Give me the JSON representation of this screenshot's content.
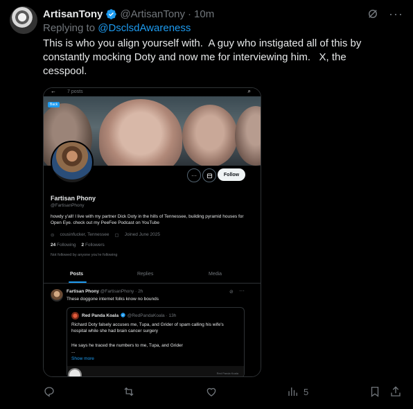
{
  "author": {
    "name": "ArtisanTony",
    "handle": "@ArtisanTony",
    "separator": "·",
    "time": "10m",
    "verified": true
  },
  "reply": {
    "prefix": "Replying to ",
    "handle": "@DsclsdAwareness"
  },
  "tweet": {
    "text": "This is who you align yourself with.  A guy who instigated all of this by constantly mocking Doty and now me for interviewing him.   X, the cesspool."
  },
  "screenshot": {
    "topbar": {
      "back": "←",
      "posts_count": "7 posts",
      "search": "⌕"
    },
    "back_chip": "Back",
    "profile": {
      "name": "Fartisan Phony",
      "handle": "@FartisanPhony",
      "bio": "howdy y'all! I live with my partner Dick Doty in the hills of Tennessee, building pyramid houses for Open Eye. check out my PeeFee Podcast on YouTube",
      "location": "cousinfucker, Tennessee",
      "joined": "Joined June 2025",
      "following_count": "24",
      "following_label": "Following",
      "followers_count": "2",
      "followers_label": "Followers",
      "not_followed": "Not followed by anyone you're following",
      "more_btn": "···",
      "follow_btn": "Follow"
    },
    "tabs": [
      "Posts",
      "Replies",
      "Media"
    ],
    "post": {
      "name": "Fartisan Phony",
      "meta": "@FartisanPhony · 2h",
      "text": "These doggone internet folks know no bounds",
      "more": "···",
      "quote": {
        "name": "Red Panda Koala",
        "meta": "@RedPandaKoala · 13h",
        "text": "Richard Doty falsely accuses me, Tupa, and Grider of spam calling his wife's hospital while she had brain cancer surgery",
        "text2": "He says he traced the numbers to me, Tupa, and Grider",
        "ellipsis": "...",
        "show_more": "Show more",
        "thumb_label": "Red Panda Koala"
      }
    }
  },
  "actions": {
    "views_count": "5"
  },
  "colors": {
    "accent": "#1d9bf0",
    "muted": "#71767b",
    "text": "#e7e9ea",
    "background": "#000000"
  },
  "icons": [
    "verified-badge-icon",
    "grok-icon",
    "more-icon",
    "reply-icon",
    "repost-icon",
    "like-icon",
    "views-icon",
    "bookmark-icon",
    "share-icon"
  ]
}
